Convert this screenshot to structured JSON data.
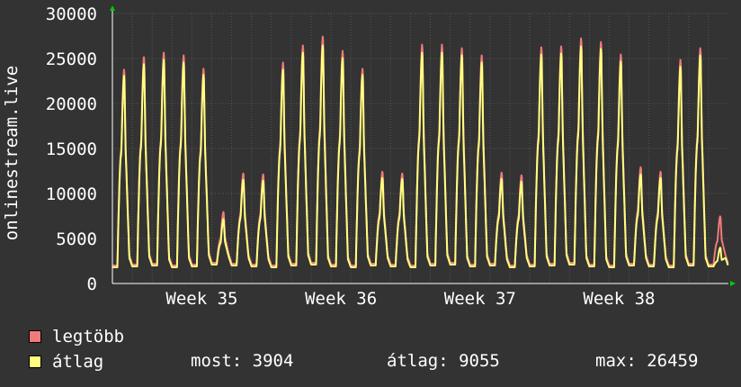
{
  "chart_data": {
    "type": "area",
    "ylabel": "onlinestream.live",
    "ylim": [
      0,
      30000
    ],
    "yticks": [
      0,
      5000,
      10000,
      15000,
      20000,
      25000,
      30000
    ],
    "xticks": [
      {
        "label": "Week 35",
        "day": 4.5
      },
      {
        "label": "Week 36",
        "day": 11.5
      },
      {
        "label": "Week 37",
        "day": 18.5
      },
      {
        "label": "Week 38",
        "day": 25.5
      }
    ],
    "grid": true,
    "series": [
      {
        "name": "legtöbb",
        "color": "#f07a7a",
        "daily_peaks": [
          23900,
          25300,
          25800,
          25500,
          24000,
          8000,
          12300,
          12200,
          24700,
          26600,
          27600,
          26000,
          24000,
          12500,
          12300,
          26700,
          26700,
          26300,
          25500,
          12400,
          12100,
          26400,
          26500,
          27400,
          27000,
          25600,
          13000,
          12500,
          25000,
          26300,
          7500
        ],
        "daily_lows": [
          2000,
          2100,
          2200,
          2000,
          2100,
          2300,
          2200,
          2100,
          2000,
          2200,
          2300,
          2100,
          2000,
          2200,
          2100,
          2000,
          2200,
          2300,
          2100,
          2200,
          2000,
          2100,
          2200,
          2300,
          2100,
          2000,
          2200,
          2100,
          2000,
          2200,
          2100
        ]
      },
      {
        "name": "átlag",
        "color": "#ffff80",
        "daily_peaks": [
          23200,
          24500,
          25000,
          24700,
          23300,
          7200,
          11600,
          11500,
          23900,
          25800,
          26600,
          25200,
          23300,
          11800,
          11700,
          25800,
          25800,
          25500,
          24700,
          11700,
          11400,
          25600,
          25700,
          26500,
          26200,
          24800,
          12200,
          11800,
          24200,
          25500,
          4000
        ],
        "daily_lows": [
          1800,
          1900,
          2000,
          1800,
          1900,
          2100,
          2000,
          1900,
          1800,
          2000,
          2100,
          1900,
          1800,
          2000,
          1900,
          1800,
          2000,
          2100,
          1900,
          2000,
          1800,
          1900,
          2000,
          2100,
          1900,
          1800,
          2000,
          1900,
          1800,
          2000,
          1900
        ]
      }
    ]
  },
  "legend": {
    "max_label": "legtöbb",
    "avg_label": "átlag"
  },
  "stats": {
    "now": "most: 3904",
    "avg": "átlag: 9055",
    "max": "max: 26459"
  },
  "colors": {
    "background": "#333333",
    "grid": "#555555",
    "max_series": "#f07a7a",
    "avg_series": "#ffff80",
    "axis_arrow": "#00cc00"
  }
}
